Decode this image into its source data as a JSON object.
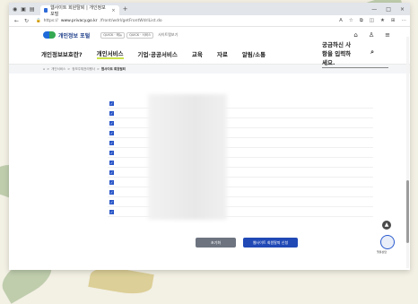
{
  "browser": {
    "tab_title": "웹사이트 회원탈퇴 | 개인정보 포털",
    "url_prefix": "https://",
    "url_domain": "www.privacy.go.kr",
    "url_path": "/front/wdrl/getFrontWdrlList.do",
    "tab_close": "×",
    "new_tab": "+",
    "win_min": "—",
    "win_max": "□",
    "win_close": "×"
  },
  "site": {
    "logo_text": "개인정보 포털",
    "pills": [
      "QUICK · 메뉴",
      "QUICK · 서비스"
    ],
    "sitemap": "사이트맵보기",
    "gnb": [
      "개인정보보호란?",
      "개인서비스",
      "기업·공공서비스",
      "교육",
      "자료",
      "알림/소통"
    ],
    "search_placeholder": "궁금하신 사항을 입력하세요.",
    "breadcrumb": [
      "개인서비스",
      "정보주체권리행사",
      "웹사이트 회원탈퇴"
    ]
  },
  "checkbox_rows": 12,
  "buttons": {
    "reset": "초기화",
    "submit": "웹사이트 회원탈퇴 신청"
  },
  "chatbot_label": "챗봇상담",
  "top_btn": "▲",
  "colors": {
    "accent": "#2049b6",
    "highlight": "#cbe34a"
  }
}
